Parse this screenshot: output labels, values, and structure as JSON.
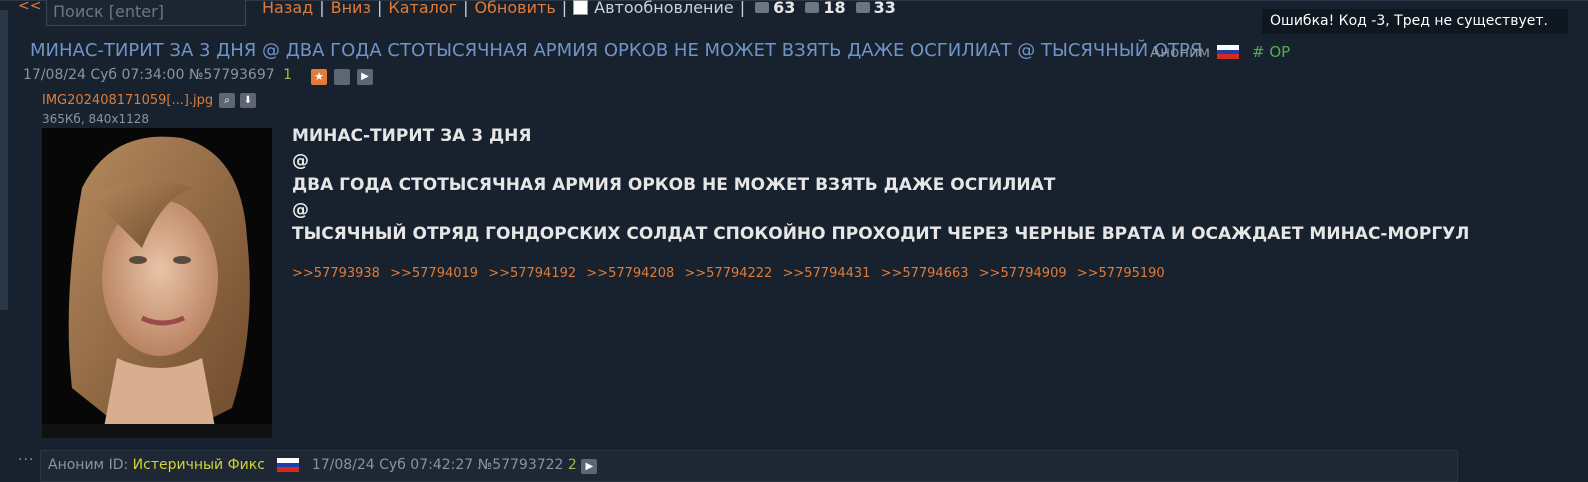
{
  "topbar": {
    "back_label": "<<",
    "search_placeholder": "Поиск [enter]",
    "nav": {
      "back": "Назад",
      "down": "Вниз",
      "catalog": "Каталог",
      "refresh": "Обновить",
      "auto_refresh": "Автообновление"
    },
    "stats": {
      "posts": "63",
      "images": "18",
      "posters": "33"
    }
  },
  "error_message": "Ошибка! Код -3, Тред не существует.",
  "thread": {
    "title": "МИНАС-ТИРИТ ЗА 3 ДНЯ @ ДВА ГОДА СТОТЫСЯЧНАЯ АРМИЯ ОРКОВ НЕ МОЖЕТ ВЗЯТЬ ДАЖЕ ОСГИЛИАТ @ ТЫСЯЧНЫЙ ОТРЯ",
    "poster": "Аноним",
    "op_tag": "# OP",
    "datetime": "17/08/24 Суб 07:34:00",
    "post_number": "№57793697",
    "reply_index": "1",
    "file": {
      "name": "IMG202408171059[...].jpg",
      "info": "365Кб, 840x1128"
    },
    "body_lines": [
      "МИНАС-ТИРИТ ЗА 3 ДНЯ",
      "@",
      "ДВА ГОДА СТОТЫСЯЧНАЯ АРМИЯ ОРКОВ НЕ МОЖЕТ ВЗЯТЬ ДАЖЕ ОСГИЛИАТ",
      "@",
      "ТЫСЯЧНЫЙ ОТРЯД ГОНДОРСКИХ СОЛДАТ СПОКОЙНО ПРОХОДИТ ЧЕРЕЗ ЧЕРНЫЕ ВРАТА И ОСАЖДАЕТ МИНАС-МОРГУЛ"
    ],
    "replies": [
      ">>57793938",
      ">>57794019",
      ">>57794192",
      ">>57794208",
      ">>57794222",
      ">>57794431",
      ">>57794663",
      ">>57794909",
      ">>57795190"
    ]
  },
  "next_post": {
    "poster": "Аноним",
    "id_label": "ID:",
    "id_name": "Истеричный Фикс",
    "datetime": "17/08/24 Суб 07:42:27",
    "post_number": "№57793722",
    "reply_index": "2"
  },
  "colors": {
    "background": "#18222e",
    "link": "#e07b39",
    "title": "#6f94c8",
    "op": "#4caf50",
    "id_name": "#d2d23a"
  },
  "icons": [
    "comment-icon",
    "image-icon",
    "users-icon",
    "star-icon",
    "hide-icon",
    "play-icon",
    "search-icon",
    "download-icon",
    "flag-ru-icon"
  ]
}
